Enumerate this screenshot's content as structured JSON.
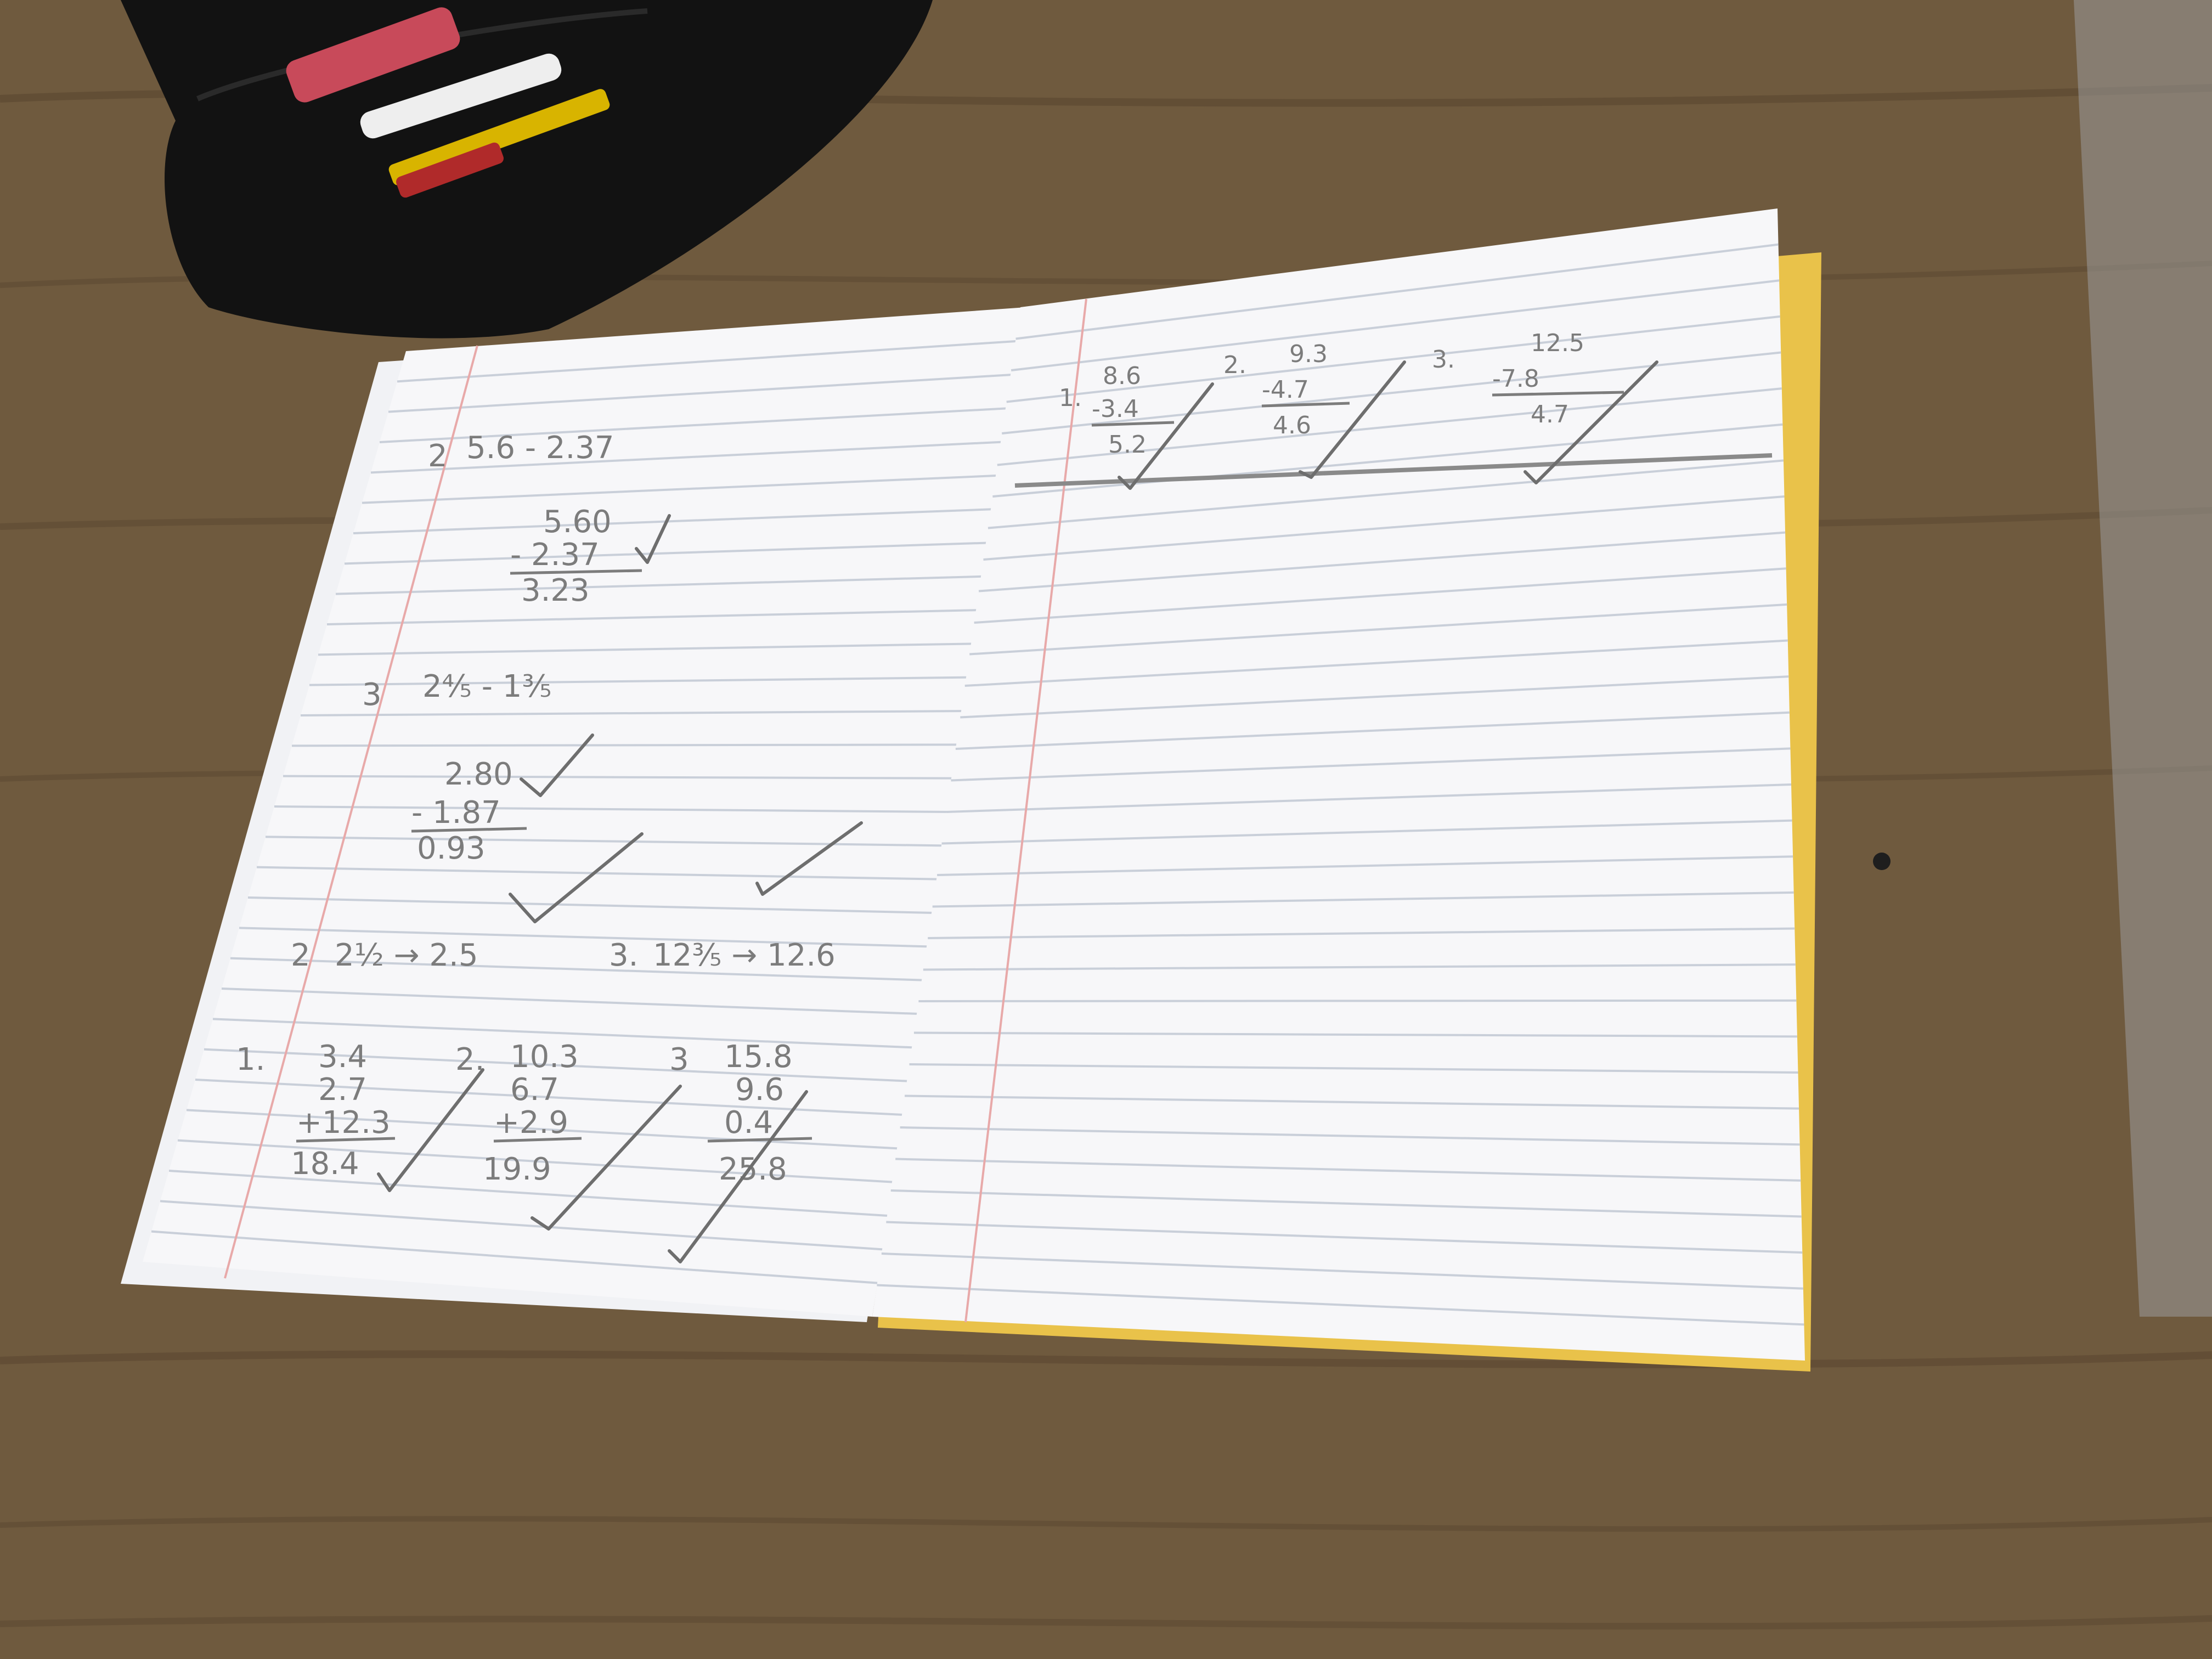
{
  "colors": {
    "desk": "#6f5a3e",
    "desk_grain": "#5a4630",
    "paper": "#f7f7f9",
    "ruled_line": "#c9cfd9",
    "margin_line": "#e8a9a9",
    "pencil": "#7c7c7c",
    "notebook_cover": "#e9c24a",
    "pencil_case": "#111111"
  },
  "left_page": {
    "problems": {
      "p1_label": "2",
      "p1_expr": "5.6 - 2.37",
      "p1_top": "5.60",
      "p1_bottom": "- 2.37",
      "p1_result": "3.23",
      "p2_label": "3",
      "p2_expr": "2⅘ - 1⅗",
      "p2_top": "2.80",
      "p2_bottom": "- 1.87",
      "p2_result": "0.93",
      "c1_label": "2",
      "c1_expr": "2½ → 2.5",
      "c2_label": "3.",
      "c2_expr": "12⅗ → 12.6",
      "s1_label": "1.",
      "s1_lines": [
        "3.4",
        "2.7",
        "+12.3",
        "18.4"
      ],
      "s2_label": "2.",
      "s2_lines": [
        "10.3",
        "6.7",
        "+2.9",
        "19.9"
      ],
      "s3_label": "3",
      "s3_lines": [
        "15.8",
        "9.6",
        "0.4",
        "25.8"
      ]
    }
  },
  "right_page": {
    "problems": {
      "r1_label": "1.",
      "r1_lines": [
        "8.6",
        "-3.4",
        "5.2"
      ],
      "r2_label": "2.",
      "r2_lines": [
        "9.3",
        "-4.7",
        "4.6"
      ],
      "r3_label": "3.",
      "r3_lines": [
        "12.5",
        "-7.8",
        "4.7"
      ]
    }
  }
}
